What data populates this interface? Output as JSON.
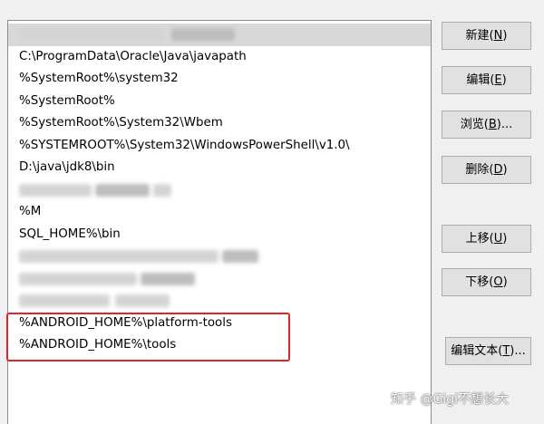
{
  "path_entries": [
    {
      "text": "C:\\ProgramData\\Oracle\\Java\\javapath"
    },
    {
      "text": "%SystemRoot%\\system32"
    },
    {
      "text": "%SystemRoot%"
    },
    {
      "text": "%SystemRoot%\\System32\\Wbem"
    },
    {
      "text": "%SYSTEMROOT%\\System32\\WindowsPowerShell\\v1.0\\"
    },
    {
      "text": "D:\\java\\jdk8\\bin"
    },
    {
      "text": "%M"
    },
    {
      "text": "SQL_HOME%\\bin"
    },
    {
      "text": "%ANDROID_HOME%\\platform-tools"
    },
    {
      "text": "%ANDROID_HOME%\\tools"
    }
  ],
  "buttons": {
    "new": {
      "label": "新建(",
      "mnemonic": "N",
      "suffix": ")"
    },
    "edit": {
      "label": "编辑(",
      "mnemonic": "E",
      "suffix": ")"
    },
    "browse": {
      "label": "浏览(",
      "mnemonic": "B",
      "suffix": ")..."
    },
    "delete": {
      "label": "删除(",
      "mnemonic": "D",
      "suffix": ")"
    },
    "move_up": {
      "label": "上移(",
      "mnemonic": "U",
      "suffix": ")"
    },
    "move_down": {
      "label": "下移(",
      "mnemonic": "O",
      "suffix": ")"
    },
    "edit_text": {
      "label": "编辑文本(",
      "mnemonic": "T",
      "suffix": ")..."
    }
  },
  "watermark": "知乎 @Gigi不想长大",
  "colors": {
    "highlight_border": "#e2242a",
    "selected_row": "#d9d9d9"
  }
}
